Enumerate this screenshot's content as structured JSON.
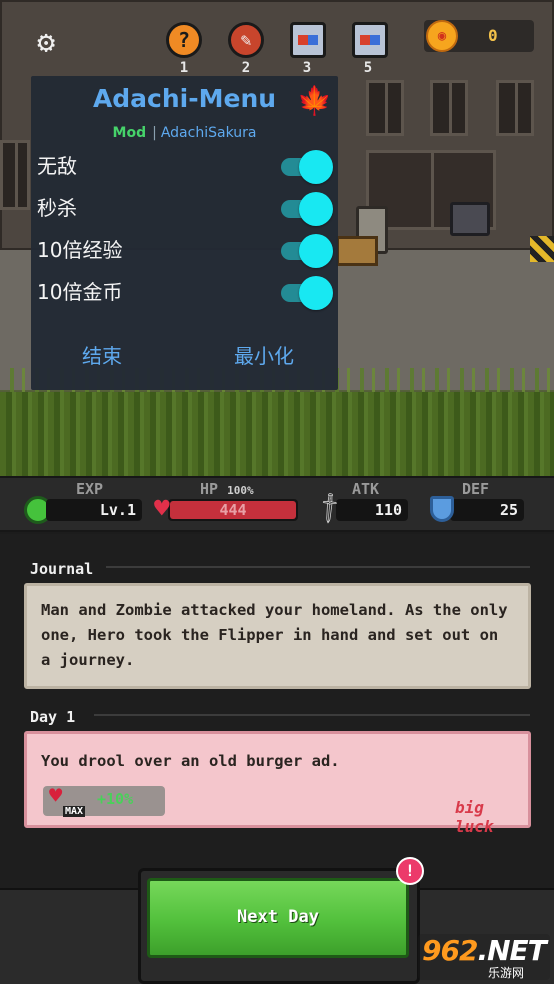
{
  "hud": {
    "settings_icon": "gear-icon",
    "buttons": [
      {
        "icon": "question-icon",
        "count": "1",
        "color": "#f08a24"
      },
      {
        "icon": "sword-badge-icon",
        "count": "2",
        "color": "#c8452c"
      },
      {
        "icon": "treasure-icon",
        "count": "3",
        "color": "#b9c4d6"
      },
      {
        "icon": "treasure-icon",
        "count": "5",
        "color": "#b9c4d6"
      }
    ],
    "coins": "0"
  },
  "mod_menu": {
    "title": "Adachi-Menu",
    "subtitle_mod": "Mod",
    "subtitle_sep": "|",
    "subtitle_author": "AdachiSakura",
    "toggles": [
      {
        "label": "无敌",
        "on": true
      },
      {
        "label": "秒杀",
        "on": true
      },
      {
        "label": "10倍经验",
        "on": true
      },
      {
        "label": "10倍金币",
        "on": true
      }
    ],
    "end_label": "结束",
    "minimize_label": "最小化",
    "accent": "#5ea9ee"
  },
  "stats": {
    "exp_title": "EXP",
    "level": "Lv.1",
    "hp_title": "HP",
    "hp_percent": "100%",
    "hp_value": "444",
    "atk_title": "ATK",
    "atk_value": "110",
    "def_title": "DEF",
    "def_value": "25"
  },
  "journal": {
    "title": "Journal",
    "text": "Man and Zombie attacked your homeland. As the only one, Hero took the Flipper in hand and set out on a journey."
  },
  "day": {
    "title": "Day 1",
    "text": "You drool over an old burger ad.",
    "bonus_tag": "MAX",
    "bonus": "+10%",
    "luck": "big luck"
  },
  "next_day": {
    "label": "Next Day",
    "badge": "!"
  },
  "watermark": {
    "logo": "962",
    "suffix": ".NET",
    "url": "乐游网"
  }
}
